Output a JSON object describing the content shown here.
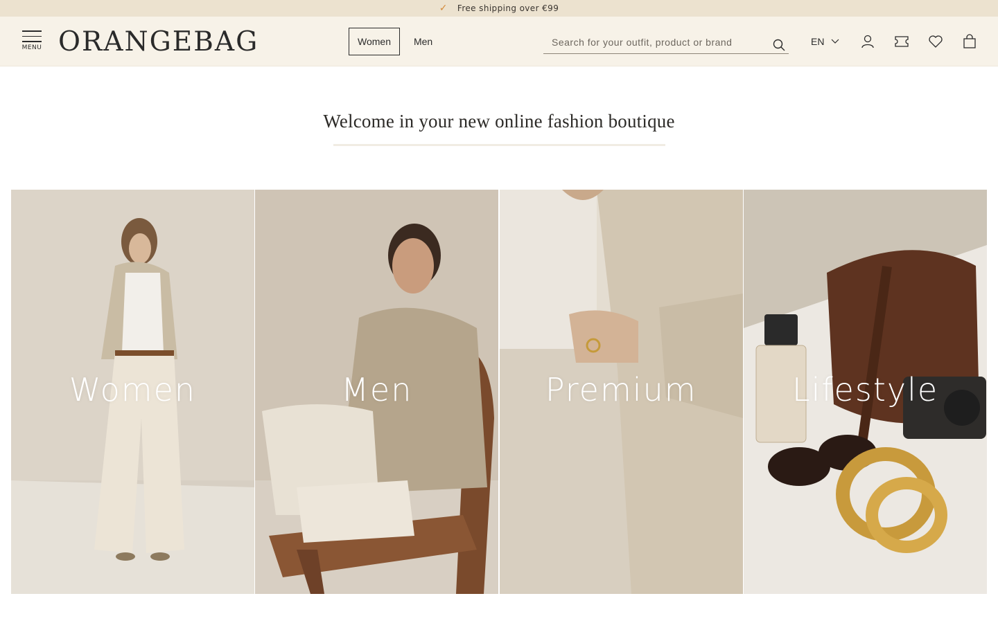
{
  "announcement": {
    "text": "Free shipping over €99",
    "icon": "check-icon"
  },
  "header": {
    "menu_label": "MENU",
    "logo": "ORANGEBAG",
    "tabs": [
      {
        "label": "Women",
        "active": true
      },
      {
        "label": "Men",
        "active": false
      }
    ],
    "search": {
      "placeholder": "Search for your outfit, product or brand",
      "value": ""
    },
    "language": "EN",
    "icons": [
      "account-icon",
      "gift-card-icon",
      "wishlist-icon",
      "cart-icon"
    ]
  },
  "headline": "Welcome in your new online fashion boutique",
  "categories": [
    {
      "label": "Women",
      "image": "woman in cream wide-leg trousers and beige vest"
    },
    {
      "label": "Men",
      "image": "man in beige wool jacket seated on wooden chair"
    },
    {
      "label": "Premium",
      "image": "close-up of beige linen blazer and trousers with gold rings"
    },
    {
      "label": "Lifestyle",
      "image": "brown suede bag, perfume bottle, sunglasses, camera and gold bracelets"
    }
  ],
  "colors": {
    "announcement_bg": "#ece2cf",
    "header_bg": "#f7f2e8",
    "check_accent": "#d48a3a",
    "text": "#2b2b2b"
  }
}
